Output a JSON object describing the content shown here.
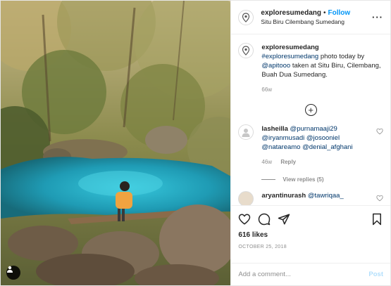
{
  "header": {
    "username": "exploresumedang",
    "separator": "•",
    "follow_label": "Follow",
    "location": "Situ Biru Cilembang Sumedang",
    "more_label": "···"
  },
  "caption": {
    "username": "exploresumedang",
    "hashtag": "#exploresumedang",
    "text_1": " photo today by ",
    "mention": "@apitooo",
    "text_2": " taken at Situ Biru, Cilembang, Buah Dua Sumedang.",
    "time": "66w"
  },
  "comments": [
    {
      "username": "lasheilla",
      "mentions": [
        "@purnamaaji29",
        "@iryanmusadi",
        "@josooniel",
        "@natareamo",
        "@denial_afghani"
      ],
      "time": "46w",
      "reply_label": "Reply",
      "view_replies": "View replies (5)"
    },
    {
      "username": "aryantinurash",
      "mentions": [
        "@tawriqaa_"
      ]
    }
  ],
  "actions": {
    "likes": "616 likes",
    "date": "OCTOBER 25, 2018"
  },
  "add_comment": {
    "placeholder": "Add a comment...",
    "post_label": "Post"
  },
  "icons": {
    "profile": "location-pin-icon",
    "load_more": "plus-circle-icon",
    "like": "heart-icon",
    "comment": "comment-bubble-icon",
    "share": "paper-plane-icon",
    "save": "bookmark-icon",
    "tagged": "person-icon"
  },
  "colors": {
    "link": "#00376b",
    "follow": "#0095f6",
    "muted": "#8e8e8e",
    "water": "#2fb4d0"
  }
}
